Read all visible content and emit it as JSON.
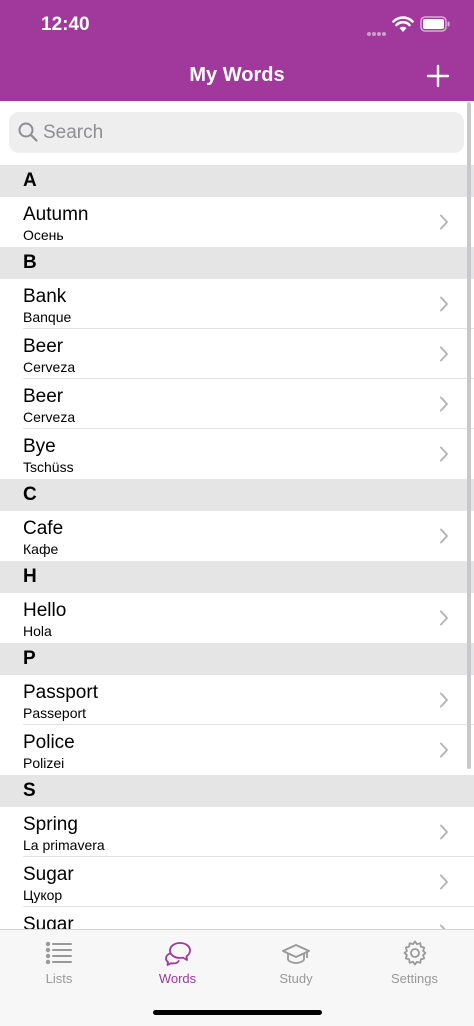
{
  "status_bar": {
    "time": "12:40"
  },
  "nav": {
    "title": "My Words",
    "add_icon": "plus-icon"
  },
  "search": {
    "placeholder": "Search",
    "value": "",
    "icon": "search-icon"
  },
  "sections": [
    {
      "letter": "A",
      "words": [
        {
          "word": "Autumn",
          "translation": "Осень"
        }
      ]
    },
    {
      "letter": "B",
      "words": [
        {
          "word": "Bank",
          "translation": "Banque"
        },
        {
          "word": "Beer",
          "translation": "Cerveza"
        },
        {
          "word": "Beer",
          "translation": "Cerveza"
        },
        {
          "word": "Bye",
          "translation": "Tschüss"
        }
      ]
    },
    {
      "letter": "C",
      "words": [
        {
          "word": "Cafe",
          "translation": "Кафе"
        }
      ]
    },
    {
      "letter": "H",
      "words": [
        {
          "word": "Hello",
          "translation": "Hola"
        }
      ]
    },
    {
      "letter": "P",
      "words": [
        {
          "word": "Passport",
          "translation": "Passeport"
        },
        {
          "word": "Police",
          "translation": "Polizei"
        }
      ]
    },
    {
      "letter": "S",
      "words": [
        {
          "word": "Spring",
          "translation": "La primavera"
        },
        {
          "word": "Sugar",
          "translation": "Цукор"
        },
        {
          "word": "Sugar",
          "translation": ""
        }
      ]
    }
  ],
  "tabs": [
    {
      "label": "Lists",
      "icon": "list-icon",
      "active": false
    },
    {
      "label": "Words",
      "icon": "chat-bubbles-icon",
      "active": true
    },
    {
      "label": "Study",
      "icon": "graduation-cap-icon",
      "active": false
    },
    {
      "label": "Settings",
      "icon": "gear-icon",
      "active": false
    }
  ],
  "colors": {
    "accent": "#a0399b",
    "section_bg": "#e5e5e5",
    "inactive_tab": "#999999"
  }
}
